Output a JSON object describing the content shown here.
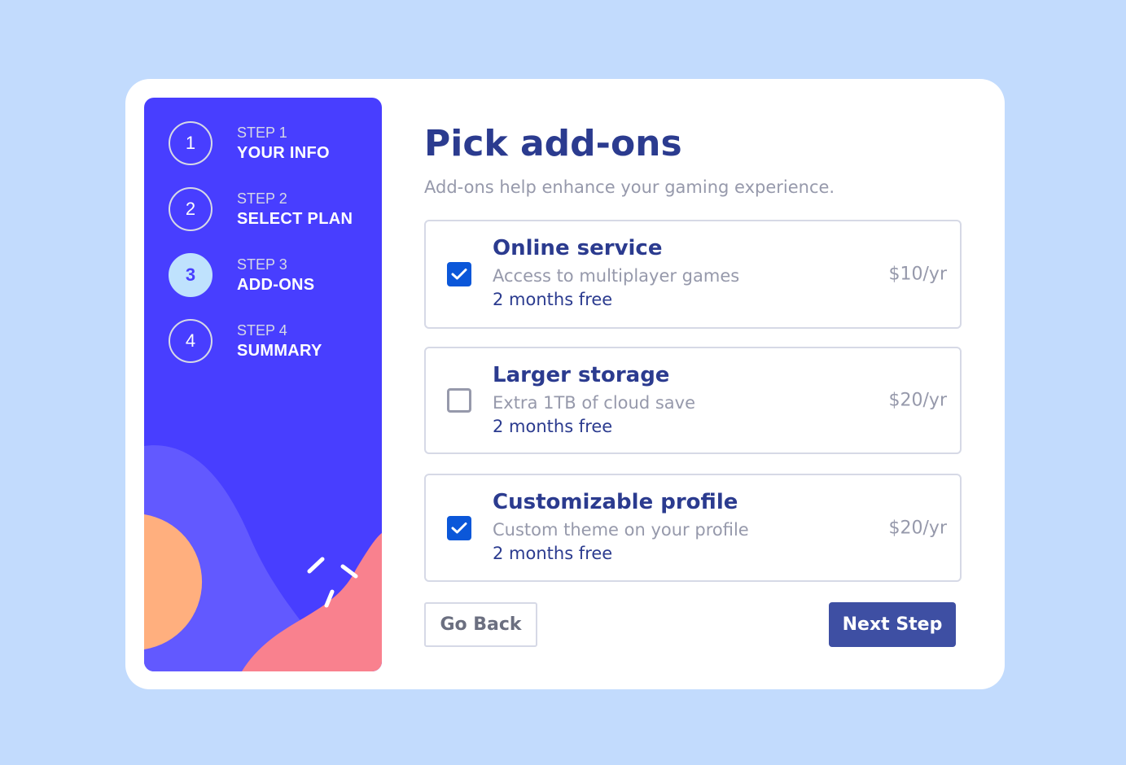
{
  "sidebar": {
    "steps": [
      {
        "number": "1",
        "label": "STEP 1",
        "name": "YOUR INFO",
        "active": false
      },
      {
        "number": "2",
        "label": "STEP 2",
        "name": "SELECT PLAN",
        "active": false
      },
      {
        "number": "3",
        "label": "STEP 3",
        "name": "ADD-ONS",
        "active": true
      },
      {
        "number": "4",
        "label": "STEP 4",
        "name": "SUMMARY",
        "active": false
      }
    ]
  },
  "main": {
    "title": "Pick add-ons",
    "subtitle": "Add-ons help enhance your gaming experience.",
    "addons": [
      {
        "name": "Online service",
        "description": "Access to multiplayer games",
        "promo": "2 months free",
        "price": "$10/yr",
        "checked": true
      },
      {
        "name": "Larger storage",
        "description": "Extra 1TB of cloud save",
        "promo": "2 months free",
        "price": "$20/yr",
        "checked": false
      },
      {
        "name": "Customizable profile",
        "description": "Custom theme on your profile",
        "promo": "2 months free",
        "price": "$20/yr",
        "checked": true
      }
    ],
    "back_label": "Go Back",
    "next_label": "Next Step"
  },
  "colors": {
    "page_bg": "#c2dbfd",
    "sidebar_bg": "#483eff",
    "accent": "#3e4fa3",
    "checkbox": "#0b57d9"
  }
}
